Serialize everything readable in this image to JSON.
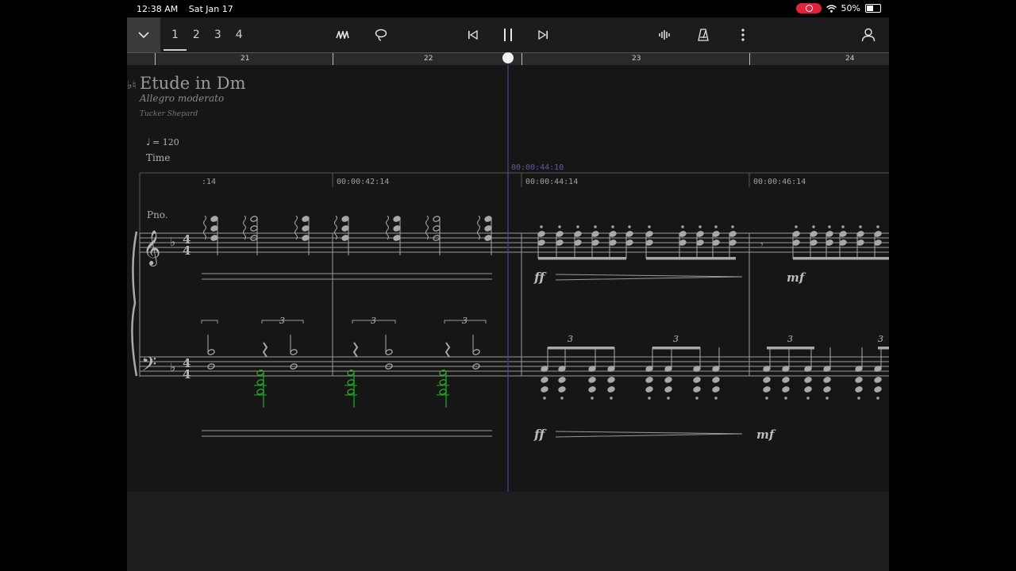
{
  "status": {
    "time": "12:38 AM",
    "date": "Sat Jan 17",
    "battery": "50%",
    "battery_level": 0.5
  },
  "toolbar": {
    "pages": [
      "1",
      "2",
      "3",
      "4"
    ],
    "active_page": "1"
  },
  "ruler": {
    "measures": [
      "21",
      "22",
      "23",
      "24"
    ]
  },
  "score": {
    "title": "Etude in Dm",
    "title_prefix": "♭♮",
    "subtitle": "Allegro moderato",
    "composer": "Tucker Shepard",
    "tempo_note": "♩",
    "tempo_value": "= 120",
    "time_label": "Time",
    "cursor_time": "00:00:44:10",
    "timestamps": [
      ":14",
      "00:00:42:14",
      "00:00:44:14",
      "00:00:46:14"
    ],
    "instrument": "Pno.",
    "time_signature": "4/4",
    "dynamics": {
      "ff_top": "ff",
      "mf_top": "mf",
      "ff_bottom": "ff",
      "mf_bottom": "mf"
    },
    "triplet": "3"
  },
  "colors": {
    "highlight_note": "#22b022",
    "cursor": "#5a5aa0",
    "notation": "#c8c8c8"
  }
}
